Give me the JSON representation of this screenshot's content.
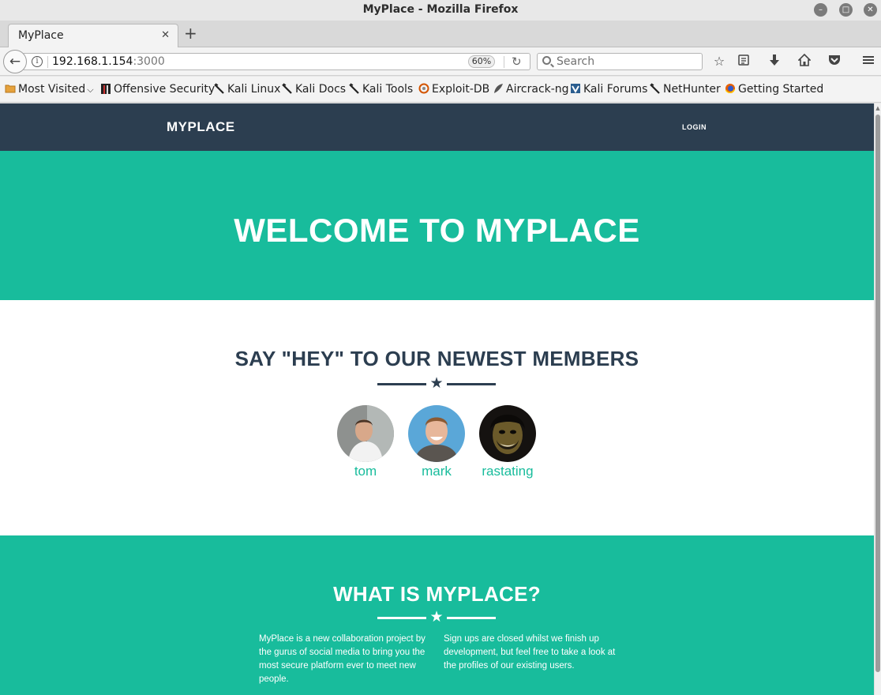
{
  "window": {
    "title": "MyPlace - Mozilla Firefox",
    "controls": [
      "minimize",
      "maximize",
      "close"
    ]
  },
  "tabs": [
    {
      "title": "MyPlace"
    }
  ],
  "toolbar": {
    "url_host": "192.168.1.154",
    "url_port": ":3000",
    "zoom": "60%",
    "search_placeholder": "Search"
  },
  "bookmarks": [
    {
      "label": "Most Visited",
      "icon": "folder-icon"
    },
    {
      "label": "Offensive Security",
      "icon": "offsec-icon"
    },
    {
      "label": "Kali Linux",
      "icon": "kali-dragon-icon"
    },
    {
      "label": "Kali Docs",
      "icon": "kali-dragon-icon"
    },
    {
      "label": "Kali Tools",
      "icon": "kali-dragon-icon"
    },
    {
      "label": "Exploit-DB",
      "icon": "exploitdb-icon"
    },
    {
      "label": "Aircrack-ng",
      "icon": "aircrack-icon"
    },
    {
      "label": "Kali Forums",
      "icon": "kali-forums-icon"
    },
    {
      "label": "NetHunter",
      "icon": "kali-dragon-icon"
    },
    {
      "label": "Getting Started",
      "icon": "firefox-icon"
    }
  ],
  "site": {
    "brand": "MYPLACE",
    "nav_login": "LOGIN",
    "hero_title": "WELCOME TO MYPLACE",
    "members_heading": "SAY \"HEY\" TO OUR NEWEST MEMBERS",
    "members": [
      {
        "name": "tom"
      },
      {
        "name": "mark"
      },
      {
        "name": "rastating"
      }
    ],
    "about_heading": "WHAT IS MYPLACE?",
    "about_left": "MyPlace is a new collaboration project by the gurus of social media to bring you the most secure platform ever to meet new people.",
    "about_right": "Sign ups are closed whilst we finish up development, but feel free to take a look at the profiles of our existing users."
  },
  "colors": {
    "navbar": "#2c3e50",
    "accent": "#18bc9c"
  }
}
